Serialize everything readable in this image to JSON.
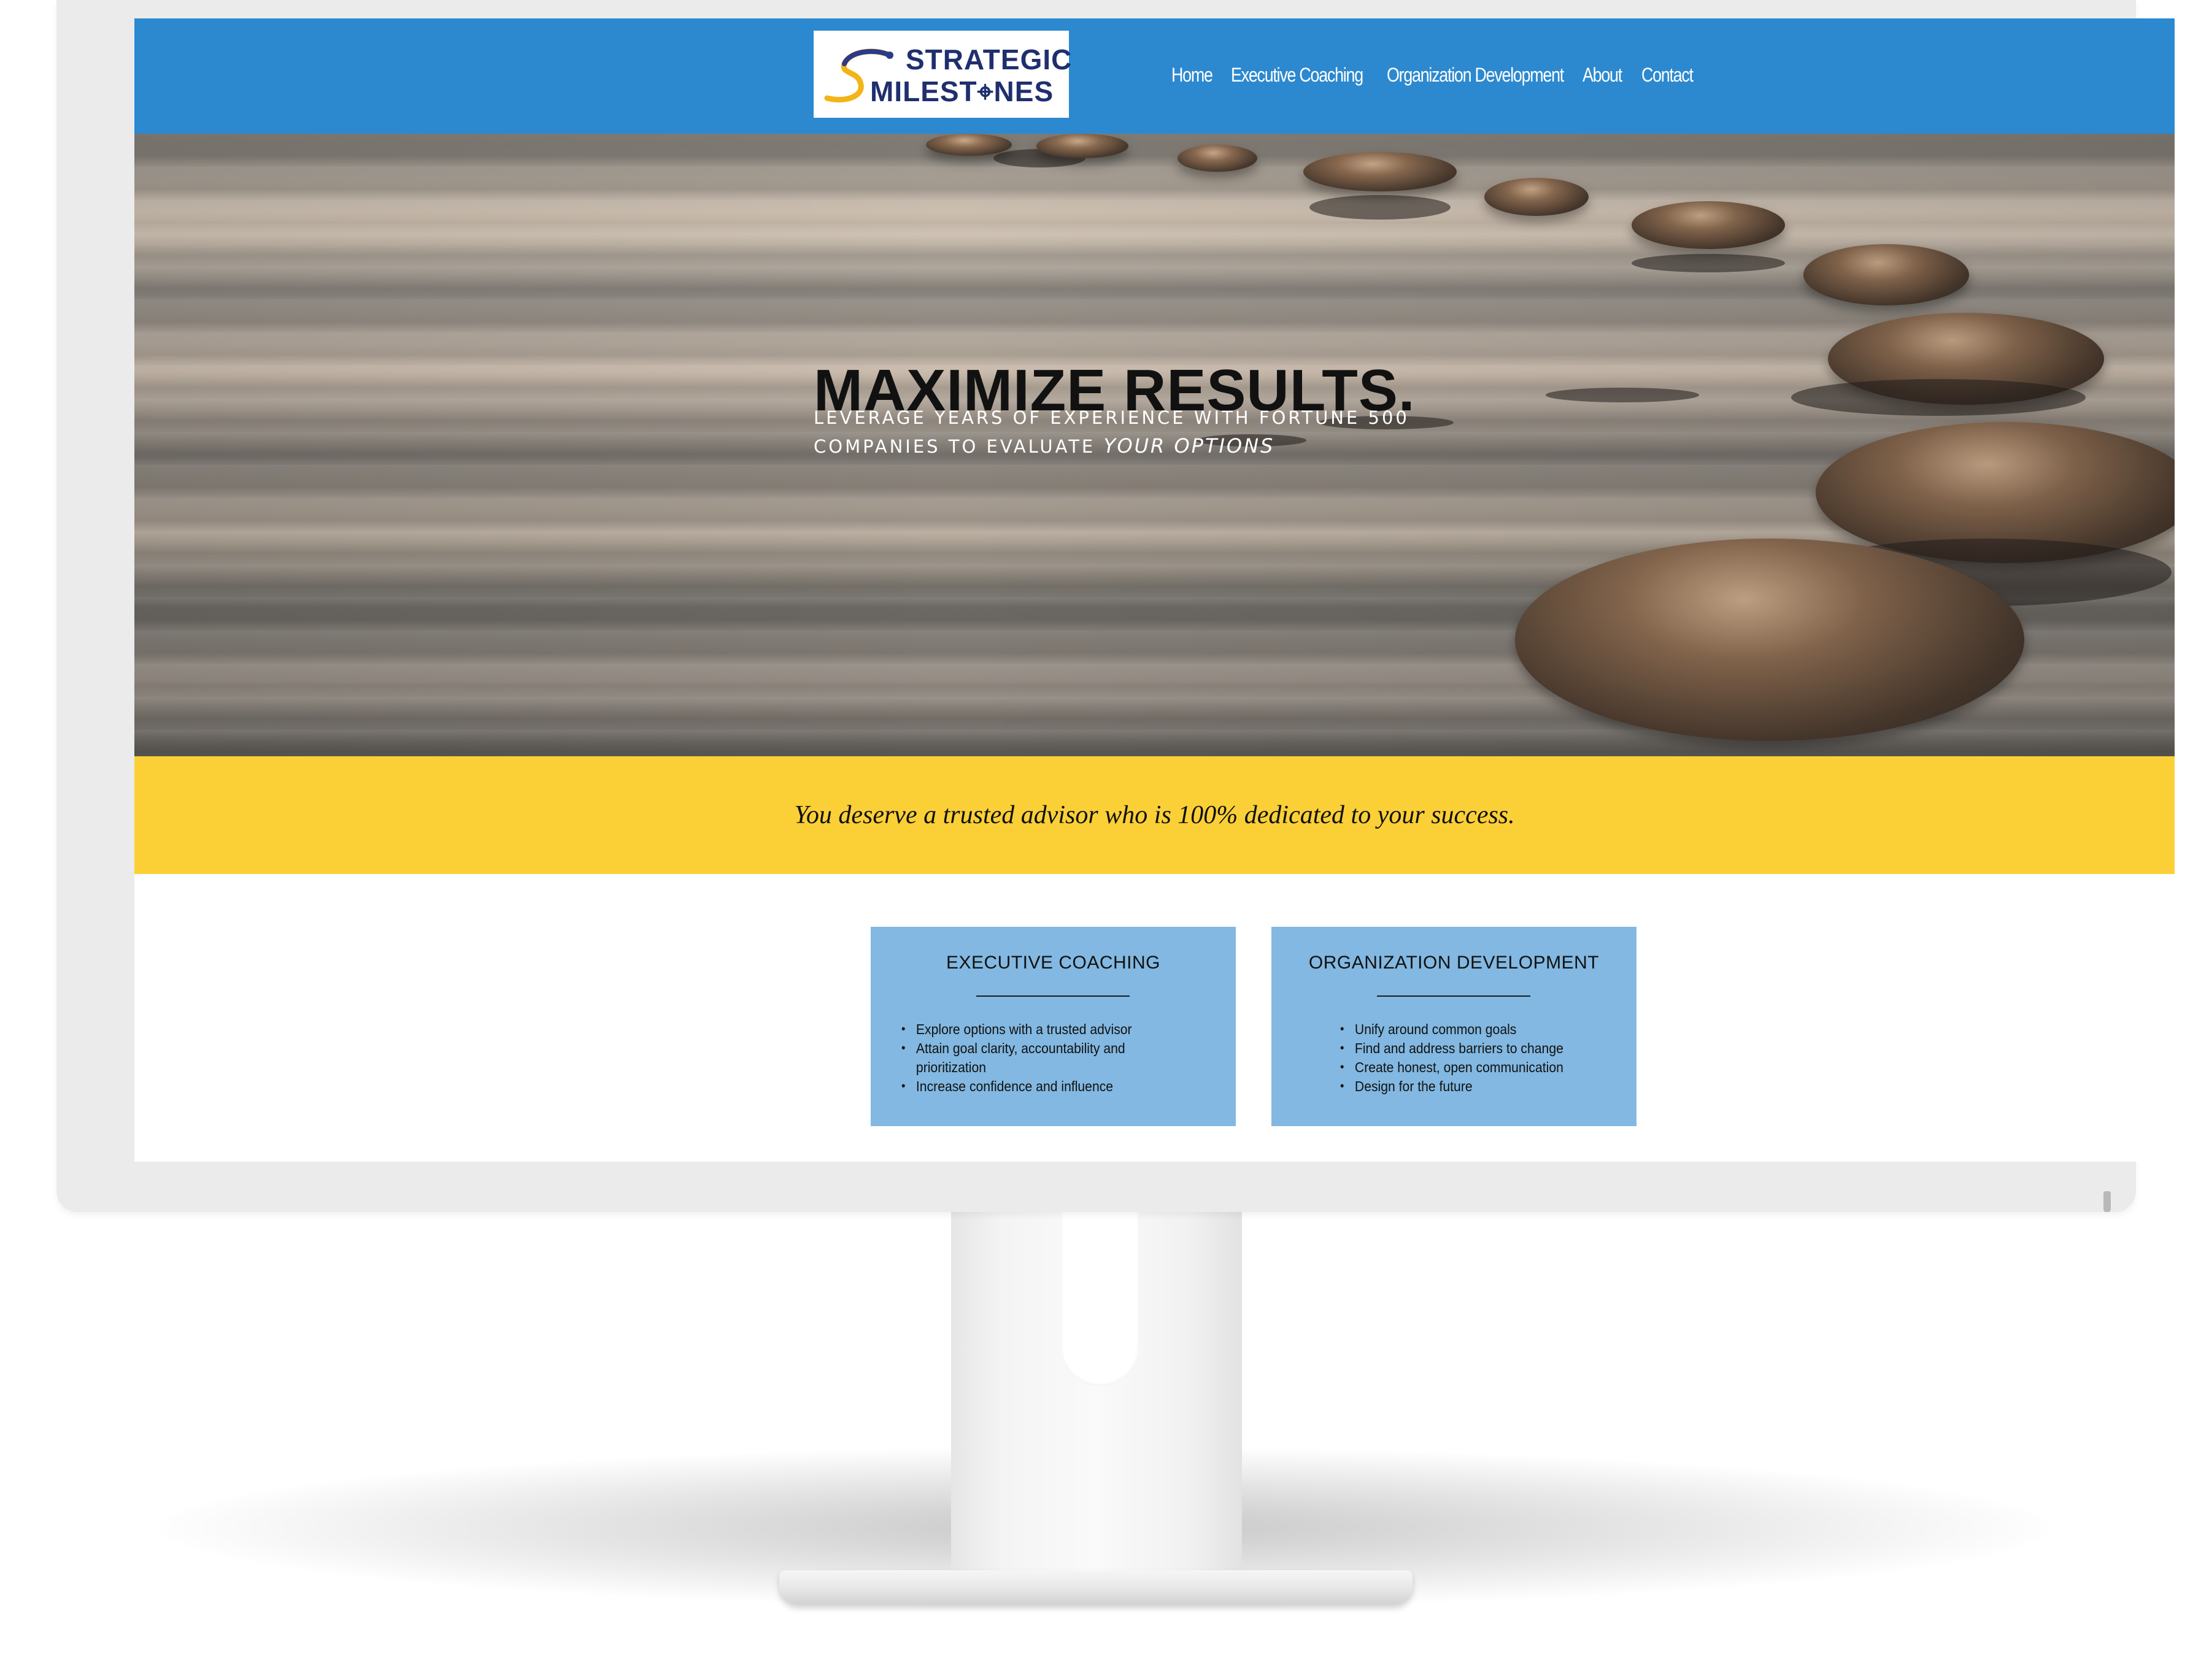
{
  "logo": {
    "line1": "STRATEGIC",
    "line2": "MILEST⌖NES",
    "colors": {
      "navy": "#1f2f6e",
      "gold": "#f2b417",
      "teal": "#2a9bbf"
    }
  },
  "nav": {
    "items": [
      {
        "label": "Home"
      },
      {
        "label": "Executive Coaching"
      },
      {
        "label": "Organization Development"
      },
      {
        "label": "About"
      },
      {
        "label": "Contact"
      }
    ]
  },
  "hero": {
    "title": "MAXIMIZE RESULTS.",
    "subtitle_line1": "LEVERAGE YEARS OF EXPERIENCE WITH FORTUNE 500",
    "subtitle_line2": "COMPANIES TO EVALUATE",
    "subtitle_emphasis": "YOUR OPTIONS"
  },
  "banner": {
    "text": "You deserve a trusted advisor who is 100% dedicated to your success."
  },
  "cards": [
    {
      "title": "EXECUTIVE COACHING",
      "items": [
        "Explore options with a trusted advisor",
        "Attain goal clarity, accountability and prioritization",
        "Increase confidence and influence"
      ]
    },
    {
      "title": "ORGANIZATION DEVELOPMENT",
      "items": [
        "Unify around common goals",
        "Find and address barriers to change",
        "Create honest, open communication",
        "Design for the future"
      ]
    }
  ],
  "theme": {
    "header_blue": "#2c89cf",
    "banner_yellow": "#fbd037",
    "card_blue": "#82b8e1"
  }
}
